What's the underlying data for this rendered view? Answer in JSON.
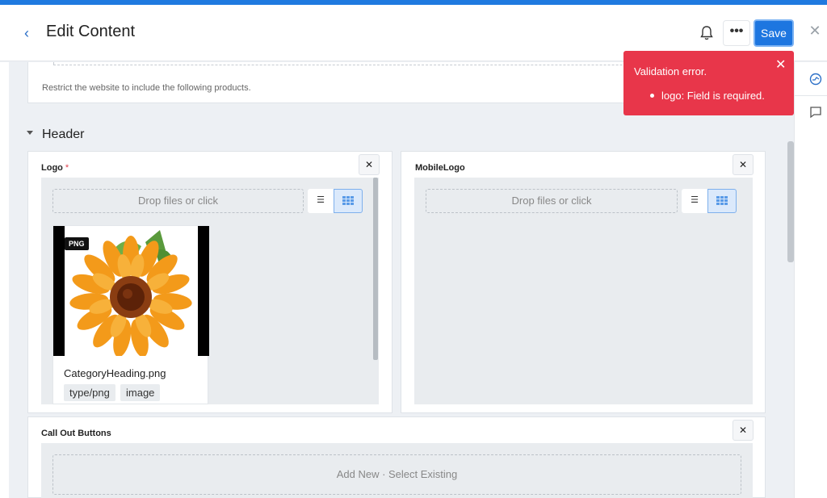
{
  "header": {
    "back_label": "‹",
    "title": "Edit Content",
    "more_label": "•••",
    "save_label": "Save",
    "close_label": "✕"
  },
  "top_card": {
    "hint": "Restrict the website to include the following products."
  },
  "section": {
    "title": "Header"
  },
  "logo_field": {
    "label": "Logo",
    "required_mark": "*",
    "remove_label": "✕",
    "drop_placeholder": "Drop files or click",
    "list_view_label": "☰",
    "file": {
      "badge": "PNG",
      "name": "CategoryHeading.png",
      "tags": [
        "type/png",
        "image"
      ]
    }
  },
  "mobile_logo_field": {
    "label": "MobileLogo",
    "remove_label": "✕",
    "drop_placeholder": "Drop files or click",
    "list_view_label": "☰"
  },
  "callout_field": {
    "label": "Call Out Buttons",
    "remove_label": "✕",
    "add_label": "Add New · Select Existing"
  },
  "toast": {
    "title": "Validation error.",
    "close_label": "✕",
    "items": [
      "logo: Field is required."
    ],
    "color": "#e8364a"
  },
  "colors": {
    "accent": "#1d76e0",
    "error": "#e8364a"
  }
}
